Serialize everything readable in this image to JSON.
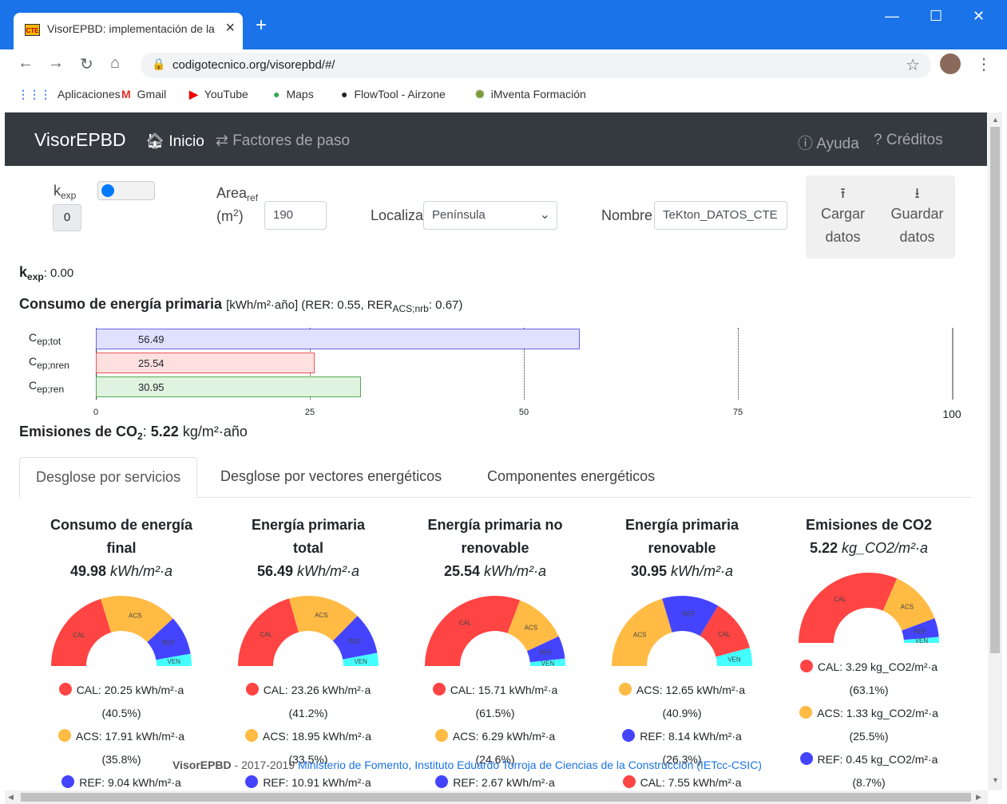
{
  "browser": {
    "tab_title": "VisorEPBD: implementación de la",
    "tab_favicon": "CTE",
    "url": "codigotecnico.org/visorepbd/#/",
    "bookmarks": [
      "Aplicaciones",
      "Gmail",
      "YouTube",
      "Maps",
      "FlowTool - Airzone",
      "iMventa Formación"
    ]
  },
  "navbar": {
    "brand": "VisorEPBD",
    "inicio": "Inicio",
    "factores": "Factores de paso",
    "ayuda": "Ayuda",
    "creditos": "Créditos"
  },
  "form": {
    "kexp_label": "k",
    "kexp_sub": "exp",
    "kexp_value": "0",
    "area_label": "Area",
    "area_sub": "ref",
    "area_unit_pre": "(m",
    "area_unit_sup": "2",
    "area_unit_post": ")",
    "area_value": "190",
    "localiza_label": "Localiza",
    "localiza_value": "Península",
    "nombre_label": "Nombre",
    "nombre_value": "TeKton_DATOS_CTE",
    "cargar_1": "Cargar",
    "cargar_2": "datos",
    "guardar_1": "Guardar",
    "guardar_2": "datos"
  },
  "summary": {
    "kexp_line_label": "k",
    "kexp_line_sub": "exp",
    "kexp_line_value": ": 0.00",
    "consumo_title": "Consumo de energía primaria",
    "consumo_units": "[kWh/m²·año] (RER: 0.55, RER",
    "consumo_rer_sub": "ACS;nrb",
    "consumo_rer_val": ": 0.67)",
    "emisiones_label": "Emisiones de CO",
    "emisiones_sub": "2",
    "emisiones_colon": ":",
    "emisiones_value": "5.22",
    "emisiones_unit": "kg/m²·año"
  },
  "bar_chart": {
    "rows": [
      {
        "label": "C",
        "sub": "ep;tot",
        "value": 56.49,
        "value_text": "56.49",
        "fill": "#e0e0ff",
        "stroke": "#6666ee"
      },
      {
        "label": "C",
        "sub": "ep;nren",
        "value": 25.54,
        "value_text": "25.54",
        "fill": "#ffe0e0",
        "stroke": "#ee5555"
      },
      {
        "label": "C",
        "sub": "ep;ren",
        "value": 30.95,
        "value_text": "30.95",
        "fill": "#e0f2e0",
        "stroke": "#55aa55"
      }
    ],
    "ticks": [
      "0",
      "25",
      "50",
      "75",
      "100"
    ],
    "xlim": [
      0,
      100
    ]
  },
  "tabs": [
    "Desglose por servicios",
    "Desglose por vectores energéticos",
    "Componentes energéticos"
  ],
  "colors": {
    "CAL": "#f44",
    "ACS": "#fb4",
    "REF": "#44f",
    "VEN": "#4ff"
  },
  "columns": [
    {
      "title_1": "Consumo de energía",
      "title_2": "final",
      "value": "49.98",
      "unit": "kWh/m²·a",
      "slices": [
        {
          "name": "CAL",
          "v": 40.5
        },
        {
          "name": "ACS",
          "v": 35.8
        },
        {
          "name": "REF",
          "v": 18.1
        },
        {
          "name": "VEN",
          "v": 5.6
        }
      ],
      "legend": [
        {
          "c": "CAL",
          "text": "CAL: 20.25 kWh/m²·a",
          "pct": "(40.5%)"
        },
        {
          "c": "ACS",
          "text": "ACS: 17.91 kWh/m²·a",
          "pct": "(35.8%)"
        },
        {
          "c": "REF",
          "text": "REF: 9.04 kWh/m²·a",
          "pct": ""
        }
      ]
    },
    {
      "title_1": "Energía primaria",
      "title_2": "total",
      "value": "56.49",
      "unit": "kWh/m²·a",
      "slices": [
        {
          "name": "CAL",
          "v": 41.2
        },
        {
          "name": "ACS",
          "v": 33.5
        },
        {
          "name": "REF",
          "v": 19.3
        },
        {
          "name": "VEN",
          "v": 6.0
        }
      ],
      "legend": [
        {
          "c": "CAL",
          "text": "CAL: 23.26 kWh/m²·a",
          "pct": "(41.2%)"
        },
        {
          "c": "ACS",
          "text": "ACS: 18.95 kWh/m²·a",
          "pct": "(33.5%)"
        },
        {
          "c": "REF",
          "text": "REF: 10.91 kWh/m²·a",
          "pct": ""
        }
      ]
    },
    {
      "title_1": "Energía primaria no",
      "title_2": "renovable",
      "value": "25.54",
      "unit": "kWh/m²·a",
      "slices": [
        {
          "name": "CAL",
          "v": 61.5
        },
        {
          "name": "ACS",
          "v": 24.6
        },
        {
          "name": "REF",
          "v": 10.5
        },
        {
          "name": "VEN",
          "v": 3.4
        }
      ],
      "legend": [
        {
          "c": "CAL",
          "text": "CAL: 15.71 kWh/m²·a",
          "pct": "(61.5%)"
        },
        {
          "c": "ACS",
          "text": "ACS: 6.29 kWh/m²·a",
          "pct": "(24.6%)"
        },
        {
          "c": "REF",
          "text": "REF: 2.67 kWh/m²·a",
          "pct": ""
        }
      ]
    },
    {
      "title_1": "Energía primaria",
      "title_2": "renovable",
      "value": "30.95",
      "unit": "kWh/m²·a",
      "slices": [
        {
          "name": "ACS",
          "v": 40.9
        },
        {
          "name": "REF",
          "v": 26.3
        },
        {
          "name": "CAL",
          "v": 24.4
        },
        {
          "name": "VEN",
          "v": 8.4
        }
      ],
      "legend": [
        {
          "c": "ACS",
          "text": "ACS: 12.65 kWh/m²·a",
          "pct": "(40.9%)"
        },
        {
          "c": "REF",
          "text": "REF: 8.14 kWh/m²·a",
          "pct": "(26.3%)"
        },
        {
          "c": "CAL",
          "text": "CAL: 7.55 kWh/m²·a",
          "pct": ""
        }
      ]
    },
    {
      "title_1": "Emisiones de CO2",
      "title_2": "",
      "value": "5.22",
      "unit": "kg_CO2/m²·a",
      "slices": [
        {
          "name": "CAL",
          "v": 63.1
        },
        {
          "name": "ACS",
          "v": 25.5
        },
        {
          "name": "REF",
          "v": 8.7
        },
        {
          "name": "VEN",
          "v": 2.7
        }
      ],
      "legend": [
        {
          "c": "CAL",
          "text": "CAL: 3.29 kg_CO2/m²·a",
          "pct": "(63.1%)"
        },
        {
          "c": "ACS",
          "text": "ACS: 1.33 kg_CO2/m²·a",
          "pct": "(25.5%)"
        },
        {
          "c": "REF",
          "text": "REF: 0.45 kg_CO2/m²·a",
          "pct": "(8.7%)"
        }
      ]
    }
  ],
  "footer": {
    "brand": "VisorEPBD",
    "years": "- 2017-2019",
    "credit": "Ministerio de Fomento, Instituto Eduardo Torroja de Ciencias de la Construcción (IETcc-CSIC)"
  }
}
